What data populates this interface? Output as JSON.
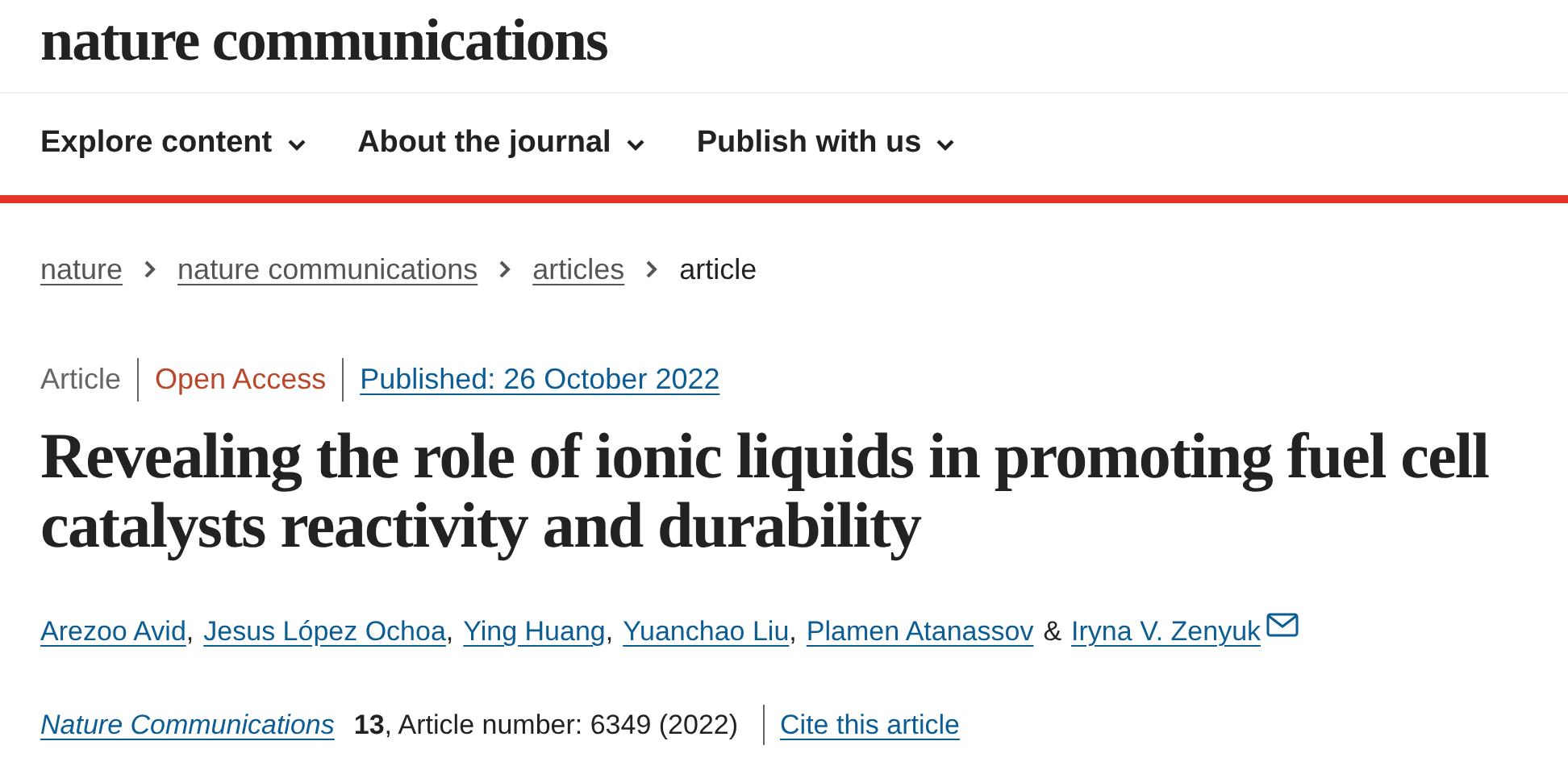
{
  "logo": "nature communications",
  "nav": [
    {
      "label": "Explore content"
    },
    {
      "label": "About the journal"
    },
    {
      "label": "Publish with us"
    }
  ],
  "breadcrumbs": [
    {
      "label": "nature",
      "link": true
    },
    {
      "label": "nature communications",
      "link": true
    },
    {
      "label": "articles",
      "link": true
    },
    {
      "label": "article",
      "link": false
    }
  ],
  "meta": [
    {
      "kind": "type",
      "text": "Article"
    },
    {
      "kind": "access",
      "text": "Open Access"
    },
    {
      "kind": "link",
      "text": "Published: 26 October 2022"
    }
  ],
  "title": "Revealing the role of ionic liquids in promoting fuel cell catalysts reactivity and durability",
  "authors": [
    {
      "name": "Arezoo Avid",
      "after": ",",
      "email": false
    },
    {
      "name": "Jesus López Ochoa",
      "after": ",",
      "email": false
    },
    {
      "name": "Ying Huang",
      "after": ",",
      "email": false
    },
    {
      "name": "Yuanchao Liu",
      "after": ",",
      "email": false
    },
    {
      "name": "Plamen Atanassov",
      "after": "&",
      "email": false
    },
    {
      "name": "Iryna V. Zenyuk",
      "email": true
    }
  ],
  "citation": {
    "journal": "Nature Communications",
    "details": "**13**, Article number: 6349 (2022)",
    "cite_link": "Cite this article"
  }
}
